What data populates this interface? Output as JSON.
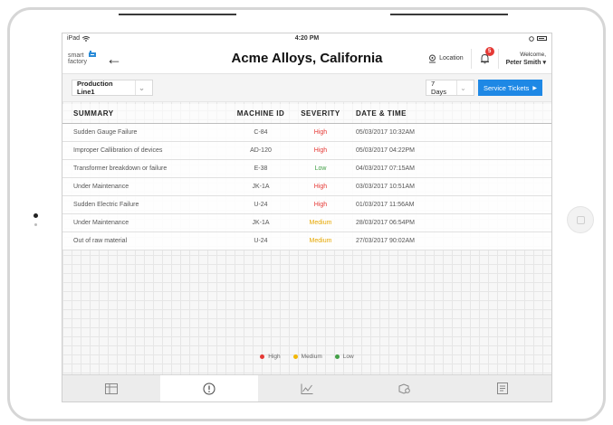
{
  "status_bar": {
    "device": "iPad",
    "time": "4:20 PM"
  },
  "header": {
    "logo_line1": "smart",
    "logo_line2": "factory",
    "title": "Acme Alloys, California",
    "location_label": "Location",
    "notification_count": "5",
    "welcome_label": "Welcome,",
    "user_name": "Peter Smith"
  },
  "filters": {
    "line_select": "Production Line1",
    "period_select": "7 Days",
    "service_tickets_label": "Service Tickets"
  },
  "table": {
    "columns": [
      "SUMMARY",
      "MACHINE ID",
      "SEVERITY",
      "DATE & TIME"
    ],
    "rows": [
      {
        "summary": "Sudden Gauge Failure",
        "machine_id": "C-84",
        "severity": "High",
        "datetime": "05/03/2017 10:32AM"
      },
      {
        "summary": "Improper Callibration of devices",
        "machine_id": "AD-120",
        "severity": "High",
        "datetime": "05/03/2017 04:22PM"
      },
      {
        "summary": "Transformer breakdown or failure",
        "machine_id": "E-38",
        "severity": "Low",
        "datetime": "04/03/2017 07:15AM"
      },
      {
        "summary": "Under Maintenance",
        "machine_id": "JK-1A",
        "severity": "High",
        "datetime": "03/03/2017 10:51AM"
      },
      {
        "summary": "Sudden Electric Failure",
        "machine_id": "U-24",
        "severity": "High",
        "datetime": "01/03/2017 11:56AM"
      },
      {
        "summary": "Under Maintenance",
        "machine_id": "JK-1A",
        "severity": "Medium",
        "datetime": "28/03/2017 06:54PM"
      },
      {
        "summary": "Out of raw material",
        "machine_id": "U-24",
        "severity": "Medium",
        "datetime": "27/03/2017 90:02AM"
      }
    ]
  },
  "legend": [
    {
      "label": "High",
      "color": "#e53935"
    },
    {
      "label": "Medium",
      "color": "#f2b705"
    },
    {
      "label": "Low",
      "color": "#43a047"
    }
  ],
  "severity_colors": {
    "High": "#e53935",
    "Medium": "#e6a700",
    "Low": "#43a047"
  },
  "bottom_tabs": [
    {
      "icon": "table-icon",
      "active": false
    },
    {
      "icon": "alert-icon",
      "active": true
    },
    {
      "icon": "chart-icon",
      "active": false
    },
    {
      "icon": "settings-box-icon",
      "active": false
    },
    {
      "icon": "report-icon",
      "active": false
    }
  ]
}
